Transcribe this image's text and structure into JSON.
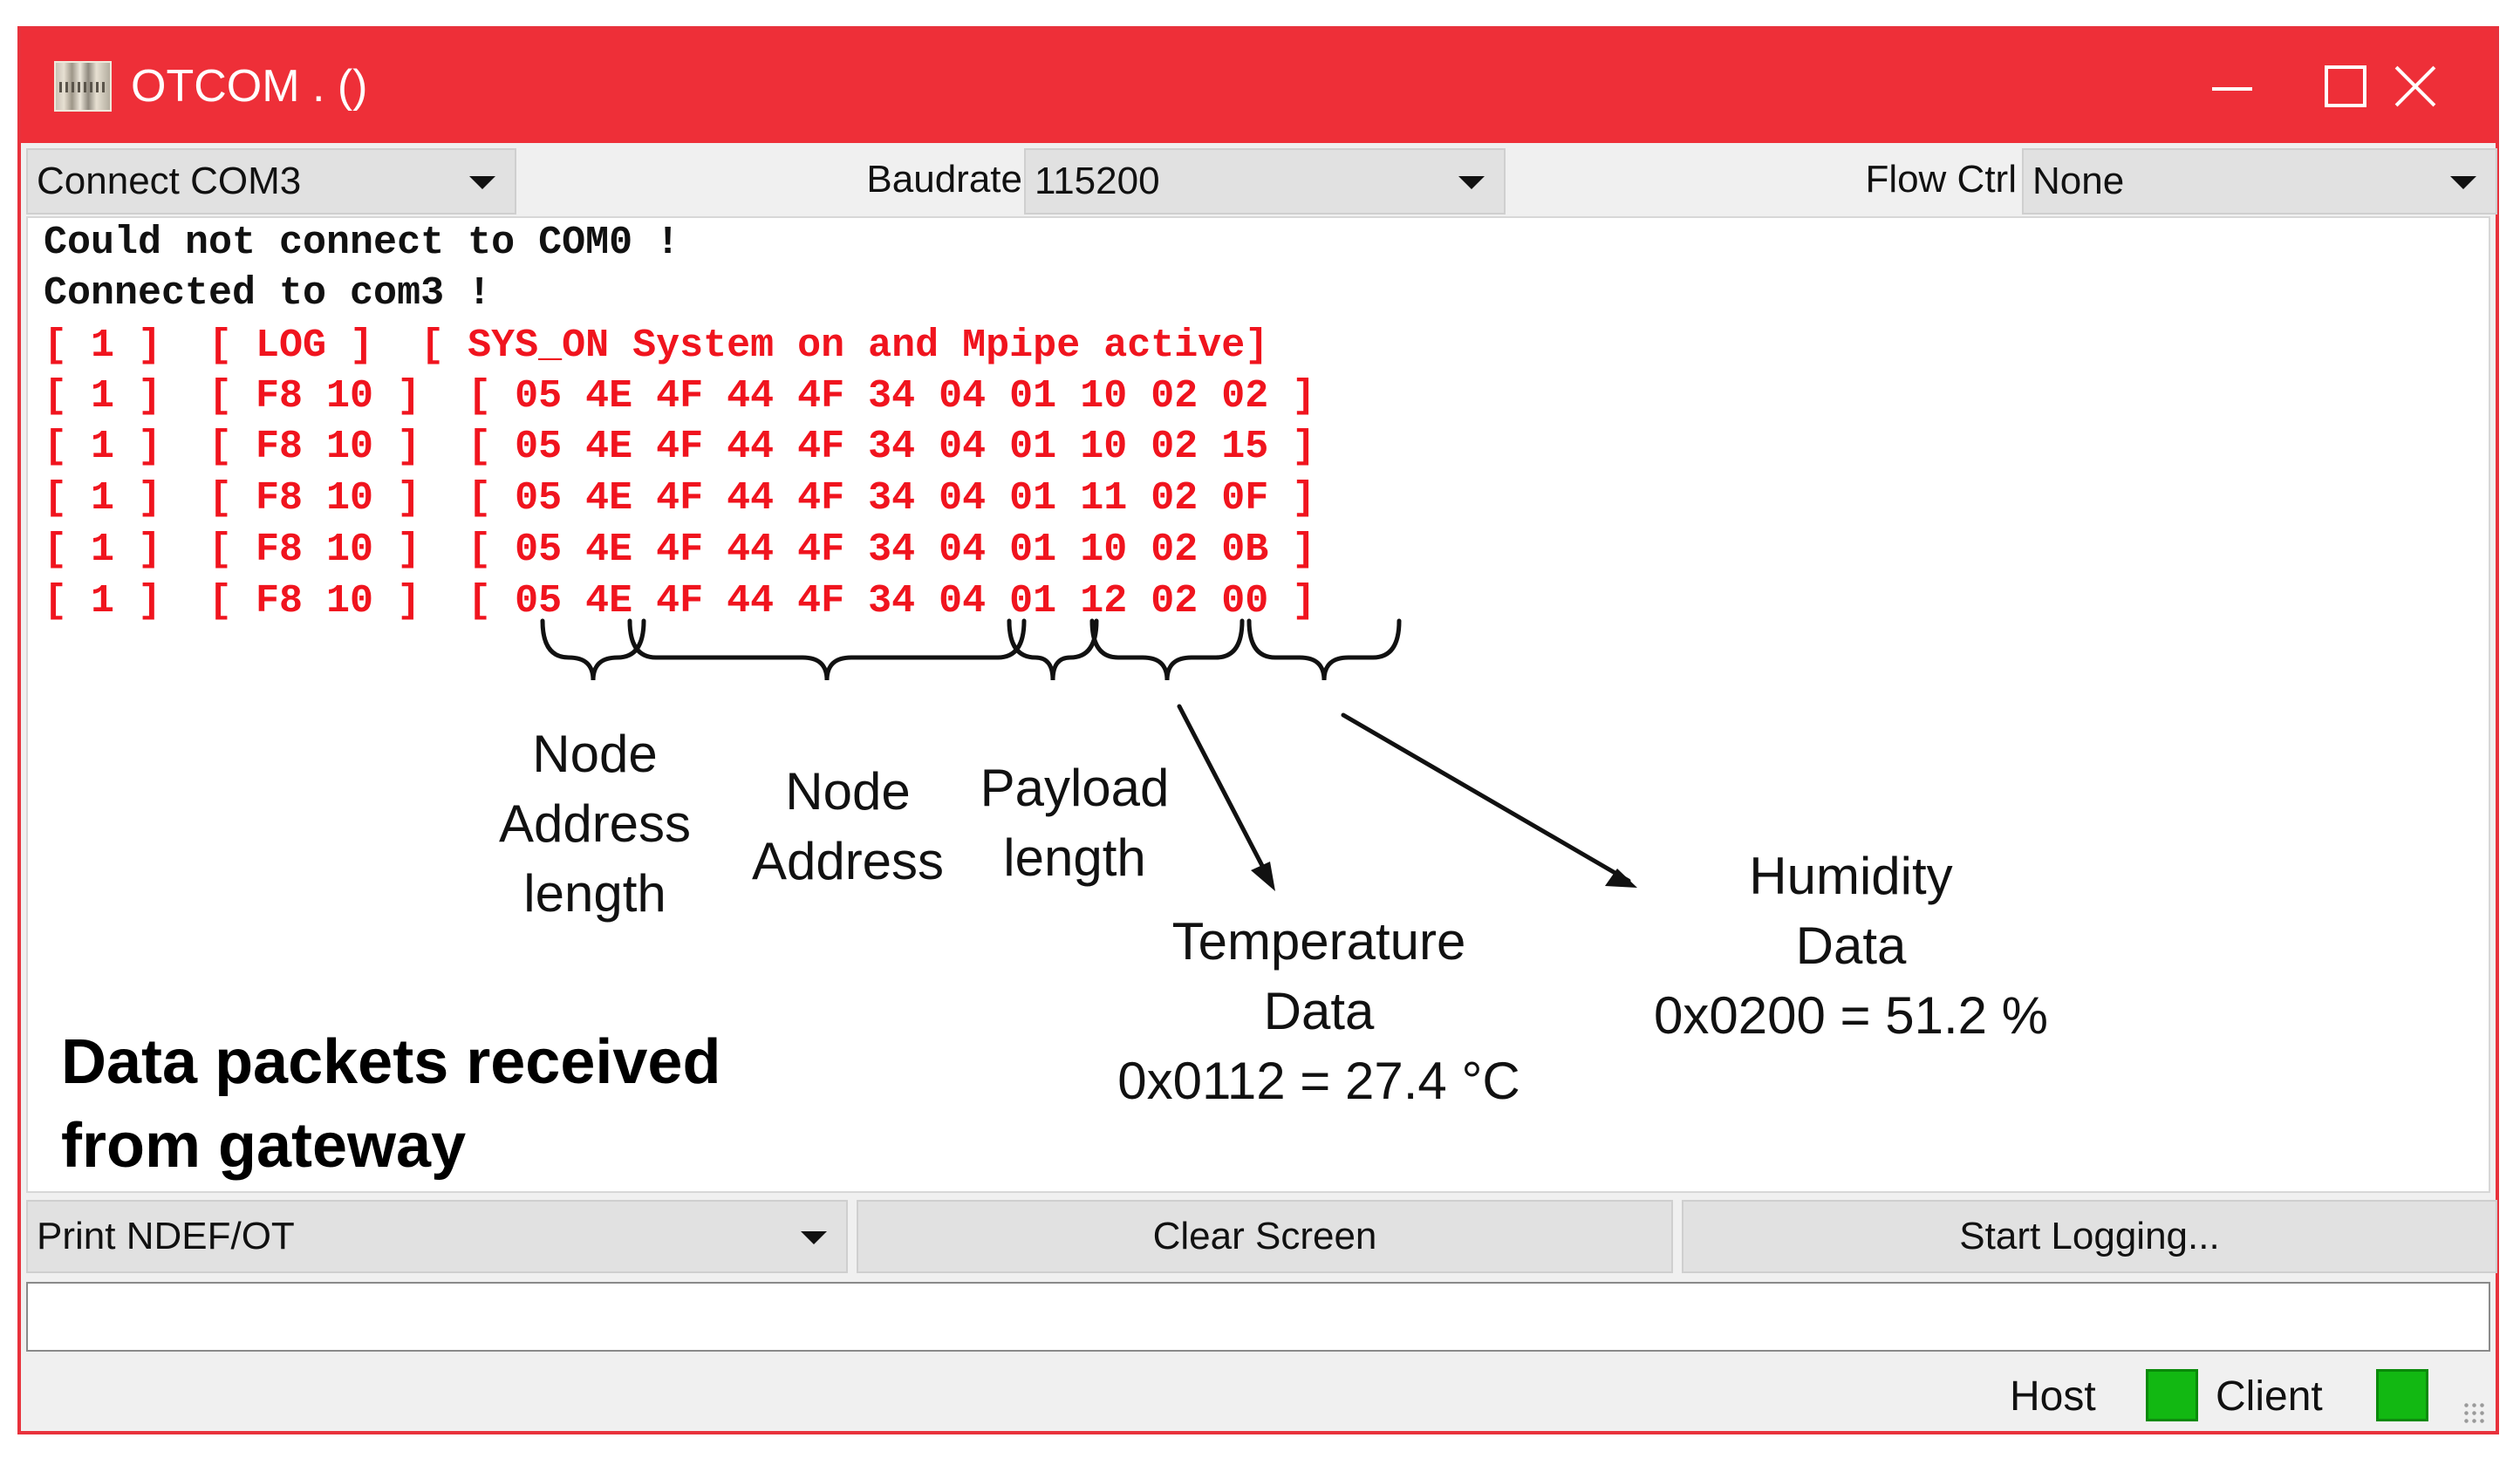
{
  "window": {
    "title": "OTCOM . ()",
    "accent_color": "#ee2f38"
  },
  "toolbar": {
    "connect_select": "Connect COM3",
    "baudrate_label": "Baudrate",
    "baudrate_value": "115200",
    "flowctrl_label": "Flow Ctrl",
    "flowctrl_value": "None"
  },
  "console": {
    "lines": [
      {
        "text": "Could not connect to COM0 !",
        "color": "black"
      },
      {
        "text": "Connected to com3 !",
        "color": "black"
      },
      {
        "text": "[ 1 ]  [ LOG ]  [ SYS_ON System on and Mpipe active]",
        "color": "red"
      },
      {
        "text": "[ 1 ]  [ F8 10 ]  [ 05 4E 4F 44 4F 34 04 01 10 02 02 ]",
        "color": "red"
      },
      {
        "text": "[ 1 ]  [ F8 10 ]  [ 05 4E 4F 44 4F 34 04 01 10 02 15 ]",
        "color": "red"
      },
      {
        "text": "[ 1 ]  [ F8 10 ]  [ 05 4E 4F 44 4F 34 04 01 11 02 0F ]",
        "color": "red"
      },
      {
        "text": "[ 1 ]  [ F8 10 ]  [ 05 4E 4F 44 4F 34 04 01 10 02 0B ]",
        "color": "red"
      },
      {
        "text": "[ 1 ]  [ F8 10 ]  [ 05 4E 4F 44 4F 34 04 01 12 02 00 ]",
        "color": "red"
      }
    ]
  },
  "annotations": {
    "node_address_length": [
      "Node",
      "Address",
      "length"
    ],
    "node_address": [
      "Node",
      "Address"
    ],
    "payload_length": [
      "Payload",
      "length"
    ],
    "temperature": [
      "Temperature",
      "Data",
      "0x0112 = 27.4 °C"
    ],
    "humidity": [
      "Humidity",
      "Data",
      "0x0200 = 51.2 %"
    ],
    "caption": [
      "Data packets received",
      "from gateway"
    ]
  },
  "bottom": {
    "print_select": "Print NDEF/OT",
    "clear_button": "Clear Screen",
    "logging_button": "Start Logging...",
    "input_value": ""
  },
  "status": {
    "host_label": "Host",
    "client_label": "Client",
    "led_color": "#12b812"
  }
}
